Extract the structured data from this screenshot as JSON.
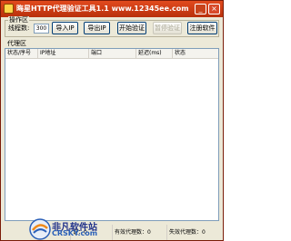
{
  "window": {
    "title": "晦星HTTP代理验证工具1.1  www.12345ee.com",
    "minimize_glyph": "_",
    "close_glyph": "×"
  },
  "operation_area": {
    "group_label": "操作区",
    "thread_label": "线程数:",
    "thread_value": "300",
    "buttons": {
      "import": "导入IP",
      "export": "导出IP",
      "start": "开始验证",
      "pause": "暂停验证",
      "register": "注册软件"
    }
  },
  "proxy_area": {
    "group_label": "代理区",
    "columns": [
      "状态/序号",
      "IP地址",
      "端口",
      "延迟(ms)",
      "状态"
    ]
  },
  "status_bar": {
    "cells": [
      "证：0",
      "有效代理数：0",
      "失效代理数：0"
    ]
  },
  "watermark": {
    "brand": "非凡软件站",
    "domain": "CRSKY.com"
  }
}
